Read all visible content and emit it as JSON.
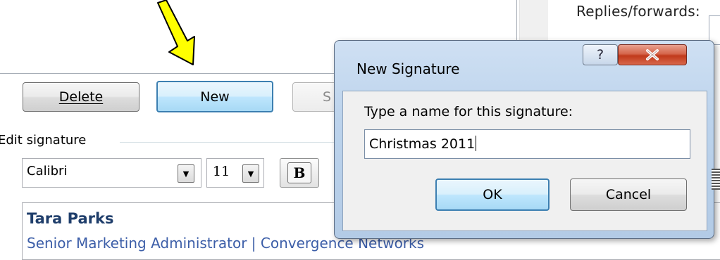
{
  "background": {
    "replies_label": "Replies/forwards:",
    "delete_label": "Delete",
    "new_label": "New",
    "save_label_partial": "S",
    "edit_signature_label": "Edit signature",
    "font_value": "Calibri",
    "size_value": "11",
    "bold_label": "B",
    "signature_name": "Tara Parks",
    "signature_title": "Senior Marketing Administrator | Convergence Networks"
  },
  "dialog": {
    "title": "New Signature",
    "help_label": "?",
    "prompt": "Type a name for this signature:",
    "input_value": "Christmas 2011",
    "ok_label": "OK",
    "cancel_label": "Cancel"
  },
  "colors": {
    "arrow": "#ffff00",
    "signature_name": "#1f3e6b",
    "signature_title": "#3c5ea8",
    "close_button": "#c0391b"
  },
  "icons": {
    "arrow": "arrow-down-left-icon",
    "help": "help-icon",
    "close": "close-icon",
    "dropdown": "chevron-down-icon"
  }
}
